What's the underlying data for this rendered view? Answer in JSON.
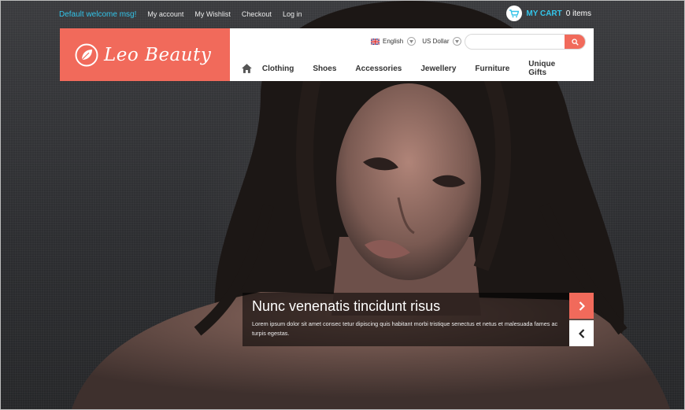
{
  "topbar": {
    "welcome": "Default welcome msg!",
    "links": [
      "My account",
      "My Wishlist",
      "Checkout",
      "Log in"
    ]
  },
  "cart": {
    "label": "MY CART",
    "count": "0 items",
    "icon": "cart-icon"
  },
  "logo": {
    "text": "Leo Beauty",
    "icon": "leaf-logo-icon"
  },
  "header": {
    "language": "English",
    "currency": "US Dollar",
    "search": {
      "placeholder": "",
      "value": ""
    }
  },
  "nav": {
    "home_icon": "home-icon",
    "items": [
      "Clothing",
      "Shoes",
      "Accessories",
      "Jewellery",
      "Furniture",
      "Unique Gifts"
    ]
  },
  "slider": {
    "title": "Nunc venenatis tincidunt risus",
    "text": "Lorem ipsum dolor sit amet consec tetur dipiscing quis  habitant morbi tristique senectus et netus et malesuada fames ac turpis egestas.",
    "next_icon": "chevron-right-icon",
    "prev_icon": "chevron-left-icon"
  },
  "colors": {
    "accent": "#f16a5b",
    "link": "#33c4e9",
    "background": "#2f3033"
  }
}
